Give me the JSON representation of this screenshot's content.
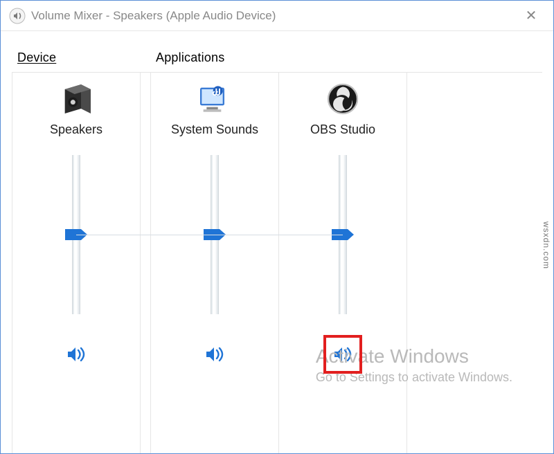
{
  "window": {
    "title": "Volume Mixer - Speakers (Apple Audio Device)"
  },
  "sections": {
    "device_label": "Device",
    "apps_label": "Applications"
  },
  "columns": [
    {
      "id": "speakers",
      "label": "Speakers",
      "icon": "speaker-box",
      "volume": 50,
      "muted": false
    },
    {
      "id": "system-sounds",
      "label": "System Sounds",
      "icon": "system-sounds",
      "volume": 50,
      "muted": false
    },
    {
      "id": "obs-studio",
      "label": "OBS Studio",
      "icon": "obs",
      "volume": 50,
      "muted": false
    }
  ],
  "watermark": {
    "line1": "Activate Windows",
    "line2": "Go to Settings to activate Windows."
  },
  "source_watermark": "wsxdn.com",
  "highlight_column": "obs-studio",
  "colors": {
    "accent": "#1f74d6",
    "highlight": "#e21f1f"
  }
}
